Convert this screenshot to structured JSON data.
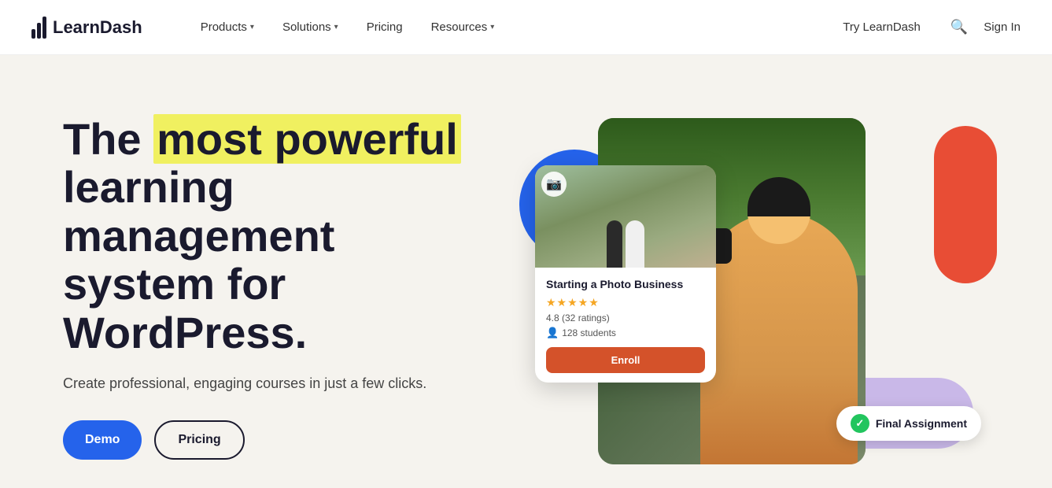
{
  "nav": {
    "logo_text": "LearnDash",
    "items": [
      {
        "label": "Products",
        "has_chevron": true
      },
      {
        "label": "Solutions",
        "has_chevron": true
      },
      {
        "label": "Pricing",
        "has_chevron": false
      },
      {
        "label": "Resources",
        "has_chevron": true
      }
    ],
    "try_label": "Try LearnDash",
    "signin_label": "Sign In"
  },
  "hero": {
    "heading_before": "The ",
    "heading_highlight": "most powerful",
    "heading_after": " learning management system for WordPress.",
    "subtext": "Create professional, engaging courses in just a few clicks.",
    "btn_demo": "Demo",
    "btn_pricing": "Pricing"
  },
  "card": {
    "title": "Starting a Photo Business",
    "stars": "★★★★★",
    "rating": "4.8 (32 ratings)",
    "students": "128 students",
    "enroll_label": "Enroll"
  },
  "badge": {
    "label": "Final Assignment"
  }
}
